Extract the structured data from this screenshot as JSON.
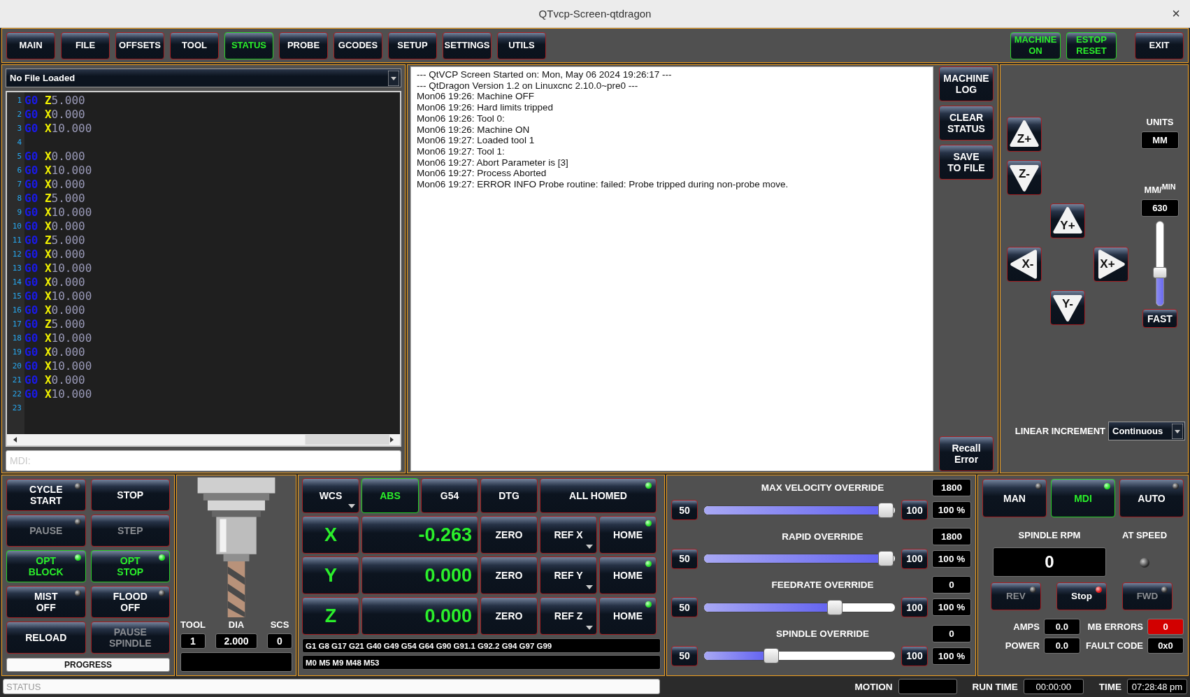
{
  "window": {
    "title": "QTvcp-Screen-qtdragon",
    "close_glyph": "×"
  },
  "nav_tabs": [
    {
      "label": "MAIN",
      "selected": false
    },
    {
      "label": "FILE",
      "selected": false
    },
    {
      "label": "OFFSETS",
      "selected": false
    },
    {
      "label": "TOOL",
      "selected": false
    },
    {
      "label": "STATUS",
      "selected": true
    },
    {
      "label": "PROBE",
      "selected": false
    },
    {
      "label": "GCODES",
      "selected": false
    },
    {
      "label": "SETUP",
      "selected": false
    },
    {
      "label": "SETTINGS",
      "selected": false
    },
    {
      "label": "UTILS",
      "selected": false
    }
  ],
  "machine_buttons": [
    {
      "label": "MACHINE\nON",
      "on": true
    },
    {
      "label": "ESTOP\nRESET",
      "on": true
    }
  ],
  "exit_button": "EXIT",
  "file_selector": {
    "value": "No File Loaded"
  },
  "editor": {
    "lines": [
      {
        "number": "1",
        "code": "G0",
        "axis": "Z",
        "value": "5.000"
      },
      {
        "number": "2",
        "code": "G0",
        "axis": "X",
        "value": "0.000"
      },
      {
        "number": "3",
        "code": "G0",
        "axis": "X",
        "value": "10.000"
      },
      {
        "number": "4"
      },
      {
        "number": "5",
        "code": "G0",
        "axis": "X",
        "value": "0.000"
      },
      {
        "number": "6",
        "code": "G0",
        "axis": "X",
        "value": "10.000"
      },
      {
        "number": "7",
        "code": "G0",
        "axis": "X",
        "value": "0.000"
      },
      {
        "number": "8",
        "code": "G0",
        "axis": "Z",
        "value": "5.000"
      },
      {
        "number": "9",
        "code": "G0",
        "axis": "X",
        "value": "10.000"
      },
      {
        "number": "10",
        "code": "G0",
        "axis": "X",
        "value": "0.000"
      },
      {
        "number": "11",
        "code": "G0",
        "axis": "Z",
        "value": "5.000"
      },
      {
        "number": "12",
        "code": "G0",
        "axis": "X",
        "value": "0.000"
      },
      {
        "number": "13",
        "code": "G0",
        "axis": "X",
        "value": "10.000"
      },
      {
        "number": "14",
        "code": "G0",
        "axis": "X",
        "value": "0.000"
      },
      {
        "number": "15",
        "code": "G0",
        "axis": "X",
        "value": "10.000"
      },
      {
        "number": "16",
        "code": "G0",
        "axis": "X",
        "value": "0.000"
      },
      {
        "number": "17",
        "code": "G0",
        "axis": "Z",
        "value": "5.000"
      },
      {
        "number": "18",
        "code": "G0",
        "axis": "X",
        "value": "10.000"
      },
      {
        "number": "19",
        "code": "G0",
        "axis": "X",
        "value": "0.000"
      },
      {
        "number": "20",
        "code": "G0",
        "axis": "X",
        "value": "10.000"
      },
      {
        "number": "21",
        "code": "G0",
        "axis": "X",
        "value": "0.000"
      },
      {
        "number": "22",
        "code": "G0",
        "axis": "X",
        "value": "10.000"
      },
      {
        "number": "23"
      }
    ]
  },
  "mdi": {
    "placeholder": "MDI:"
  },
  "log": {
    "lines": [
      "--- QtVCP Screen Started on: Mon, May 06 2024 19:26:17 ---",
      "--- QtDragon Version 1.2 on Linuxcnc 2.10.0~pre0 ---",
      "Mon06 19:26: Machine OFF",
      "Mon06 19:26: Hard limits tripped",
      "Mon06 19:26: Tool 0:",
      "Mon06 19:26: Machine ON",
      "Mon06 19:27: Loaded tool 1",
      "Mon06 19:27: Tool 1:",
      "Mon06 19:27: Abort Parameter is [3]",
      "Mon06 19:27: Process Aborted",
      "Mon06 19:27: ERROR INFO Probe routine: failed: Probe tripped during non-probe move."
    ]
  },
  "log_buttons": [
    "MACHINE\nLOG",
    "CLEAR\nSTATUS",
    "SAVE\nTO FILE"
  ],
  "recall_button": "Recall\nError",
  "jog": {
    "buttons": [
      {
        "label": "Z+",
        "kind": "up"
      },
      {
        "label": "Z-",
        "kind": "down"
      },
      {
        "label": "Y+",
        "kind": "up"
      },
      {
        "label": "X-",
        "kind": "left"
      },
      {
        "label": "X+",
        "kind": "right"
      },
      {
        "label": "Y-",
        "kind": "down"
      }
    ],
    "units_label": "UNITS",
    "units": "MM",
    "rate_label": "MM/$^{MIN}$",
    "rate": "630",
    "level": 0.38,
    "fast_button": "FAST",
    "increment_label": "LINEAR INCREMENT",
    "increment": "Continuous"
  },
  "control_buttons": [
    {
      "label": "CYCLE\nSTART",
      "kind": "lamp",
      "on": false,
      "disabled": false,
      "led": false
    },
    {
      "label": "STOP",
      "kind": "plain",
      "on": false,
      "disabled": false
    },
    {
      "label": "PAUSE",
      "kind": "lamp",
      "on": false,
      "disabled": true,
      "led": false
    },
    {
      "label": "STEP",
      "kind": "plain",
      "on": false,
      "disabled": true
    },
    {
      "label": "OPT\nBLOCK",
      "kind": "lamp",
      "on": true,
      "disabled": false,
      "led": true
    },
    {
      "label": "OPT\nSTOP",
      "kind": "lamp",
      "on": true,
      "disabled": false,
      "led": true
    },
    {
      "label": "MIST\nOFF",
      "kind": "lamp",
      "on": false,
      "disabled": false,
      "led": false
    },
    {
      "label": "FLOOD\nOFF",
      "kind": "lamp",
      "on": false,
      "disabled": false,
      "led": false
    },
    {
      "label": "RELOAD",
      "kind": "plain",
      "on": false,
      "disabled": false
    },
    {
      "label": "PAUSE\nSPINDLE",
      "kind": "plain",
      "on": false,
      "disabled": true
    }
  ],
  "progress": {
    "label": "PROGRESS",
    "level": 0
  },
  "tool": {
    "fields": [
      {
        "label": "TOOL",
        "value": "1"
      },
      {
        "label": "DIA",
        "value": "2.000"
      },
      {
        "label": "SCS",
        "value": "0"
      }
    ]
  },
  "dro": {
    "top_buttons": [
      {
        "label": "WCS",
        "kind": "dropdown",
        "on": false
      },
      {
        "label": "ABS",
        "kind": "plain",
        "on": true
      },
      {
        "label": "G54",
        "kind": "plain",
        "on": false
      },
      {
        "label": "DTG",
        "kind": "plain",
        "on": false
      },
      {
        "label": "ALL HOMED",
        "kind": "lamp",
        "on": false,
        "led": true
      }
    ],
    "axes": [
      {
        "axis": "X",
        "value": "-0.263",
        "zero": "ZERO",
        "ref": "REF X",
        "home": "HOME",
        "homed": true
      },
      {
        "axis": "Y",
        "value": "0.000",
        "zero": "ZERO",
        "ref": "REF Y",
        "home": "HOME",
        "homed": true
      },
      {
        "axis": "Z",
        "value": "0.000",
        "zero": "ZERO",
        "ref": "REF Z",
        "home": "HOME",
        "homed": true
      }
    ],
    "gcodes": "G1 G8 G17 G21 G40 G49 G54 G64 G90 G91.1 G92.2 G94 G97 G99",
    "mcodes": "M0 M5 M9 M48 M53"
  },
  "overrides": [
    {
      "title": "MAX VELOCITY OVERRIDE",
      "value": "1800",
      "min": "50",
      "max": "100",
      "percent": "100 %",
      "level": 0.99
    },
    {
      "title": "RAPID OVERRIDE",
      "value": "1800",
      "min": "50",
      "max": "100",
      "percent": "100 %",
      "level": 0.99
    },
    {
      "title": "FEEDRATE OVERRIDE",
      "value": "0",
      "min": "50",
      "max": "100",
      "percent": "100 %",
      "level": 0.7
    },
    {
      "title": "SPINDLE OVERRIDE",
      "value": "0",
      "min": "50",
      "max": "100",
      "percent": "100 %",
      "level": 0.34
    }
  ],
  "spindle": {
    "modes": [
      {
        "label": "MAN",
        "selected": false,
        "led": false
      },
      {
        "label": "MDI",
        "selected": true,
        "led": true
      },
      {
        "label": "AUTO",
        "selected": false,
        "led": false
      }
    ],
    "rpm_label": "SPINDLE RPM",
    "rpm": "0",
    "at_speed_label": "AT SPEED",
    "at_speed": false,
    "direction_buttons": [
      {
        "label": "REV",
        "disabled": true,
        "led": false
      },
      {
        "label": "Stop",
        "disabled": false,
        "led": true
      },
      {
        "label": "FWD",
        "disabled": true,
        "led": false
      }
    ],
    "readouts": [
      {
        "label": "AMPS",
        "value": "0.0",
        "alert": false
      },
      {
        "label": "MB ERRORS",
        "value": "0",
        "alert": true
      },
      {
        "label": "POWER",
        "value": "0.0",
        "alert": false
      },
      {
        "label": "FAULT CODE",
        "value": "0x0",
        "alert": false
      }
    ]
  },
  "status_bar": {
    "placeholder": "STATUS",
    "motion_label": "MOTION",
    "run_time_label": "RUN TIME",
    "run_time": "00:00:00",
    "time_label": "TIME",
    "time": "07:28:48 pm"
  }
}
